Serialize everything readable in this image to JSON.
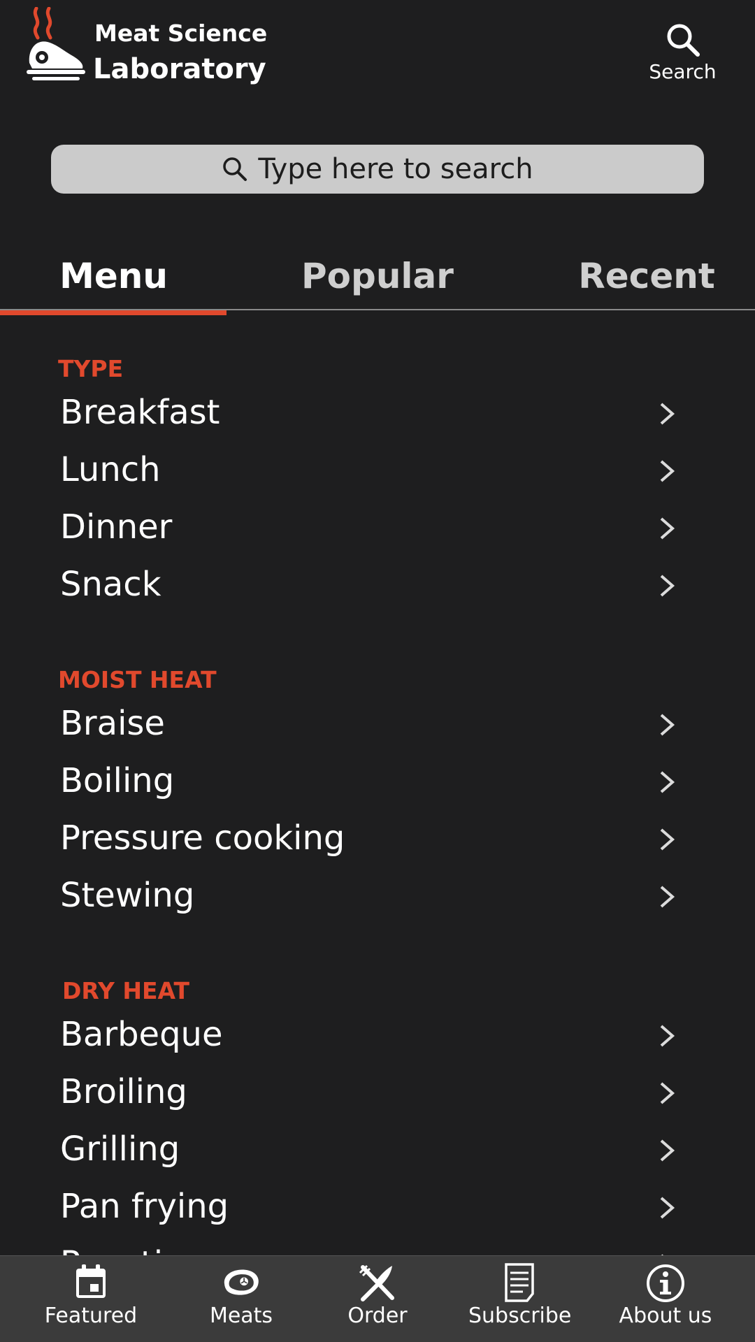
{
  "app": {
    "brand_line1": "Meat Science",
    "brand_line2": "Laboratory",
    "header_search_label": "Search",
    "logo_icon": "grilled-meat-logo-icon"
  },
  "search": {
    "placeholder": "Type here to search",
    "icon": "search-icon"
  },
  "tabs": [
    {
      "label": "Menu",
      "selected": true
    },
    {
      "label": "Popular",
      "selected": false
    },
    {
      "label": "Recent",
      "selected": false
    }
  ],
  "sections": [
    {
      "title": "TYPE",
      "items": [
        "Breakfast",
        "Lunch",
        "Dinner",
        "Snack"
      ]
    },
    {
      "title": "MOIST HEAT",
      "items": [
        "Braise",
        "Boiling",
        "Pressure cooking",
        "Stewing"
      ]
    },
    {
      "title": "DRY HEAT",
      "items": [
        "Barbeque",
        "Broiling",
        "Grilling",
        "Pan frying",
        "Roasting"
      ]
    }
  ],
  "bottom_nav": [
    {
      "label": "Featured",
      "icon": "calendar-icon"
    },
    {
      "label": "Meats",
      "icon": "steak-icon"
    },
    {
      "label": "Order",
      "icon": "fork-knife-icon"
    },
    {
      "label": "Subscribe",
      "icon": "document-icon"
    },
    {
      "label": "About us",
      "icon": "info-icon"
    }
  ],
  "colors": {
    "background": "#1e1e1f",
    "accent": "#e1492d",
    "search_bar": "#cbcbcb",
    "bottom_nav": "#3b3b3b"
  }
}
